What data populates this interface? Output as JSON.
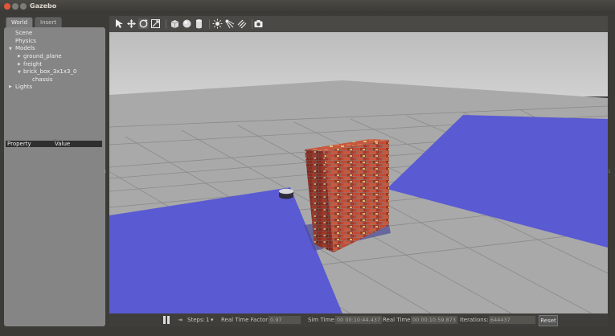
{
  "window": {
    "title": "Gazebo"
  },
  "tabs": {
    "world": "World",
    "insert": "Insert"
  },
  "tree": {
    "scene": "Scene",
    "physics": "Physics",
    "models": "Models",
    "ground_plane": "ground_plane",
    "freight": "freight",
    "brick_box": "brick_box_3x1x3_0",
    "chassis": "chassis",
    "lights": "Lights"
  },
  "properties": {
    "col_property": "Property",
    "col_value": "Value"
  },
  "toolbar": {
    "icons": [
      "select-arrow-icon",
      "translate-icon",
      "rotate-icon",
      "scale-icon",
      "box-icon",
      "sphere-icon",
      "cylinder-icon",
      "point-light-icon",
      "spot-light-icon",
      "directional-light-icon",
      "screenshot-icon"
    ]
  },
  "status": {
    "steps_label": "Steps:",
    "steps_value": "1",
    "rtf_label": "Real Time Factor:",
    "rtf_value": "0.97",
    "sim_time_label": "Sim Time:",
    "sim_time_value": "00 00:10:44.437",
    "real_time_label": "Real Time:",
    "real_time_value": "00 00:10:59.873",
    "iterations_label": "Iterations:",
    "iterations_value": "644437",
    "reset_label": "Reset"
  },
  "colors": {
    "floor_blue": "#5a5ad2",
    "ground": "#a8a8a8",
    "sky": "#c6c6c6",
    "close_button": "#e0573a"
  }
}
